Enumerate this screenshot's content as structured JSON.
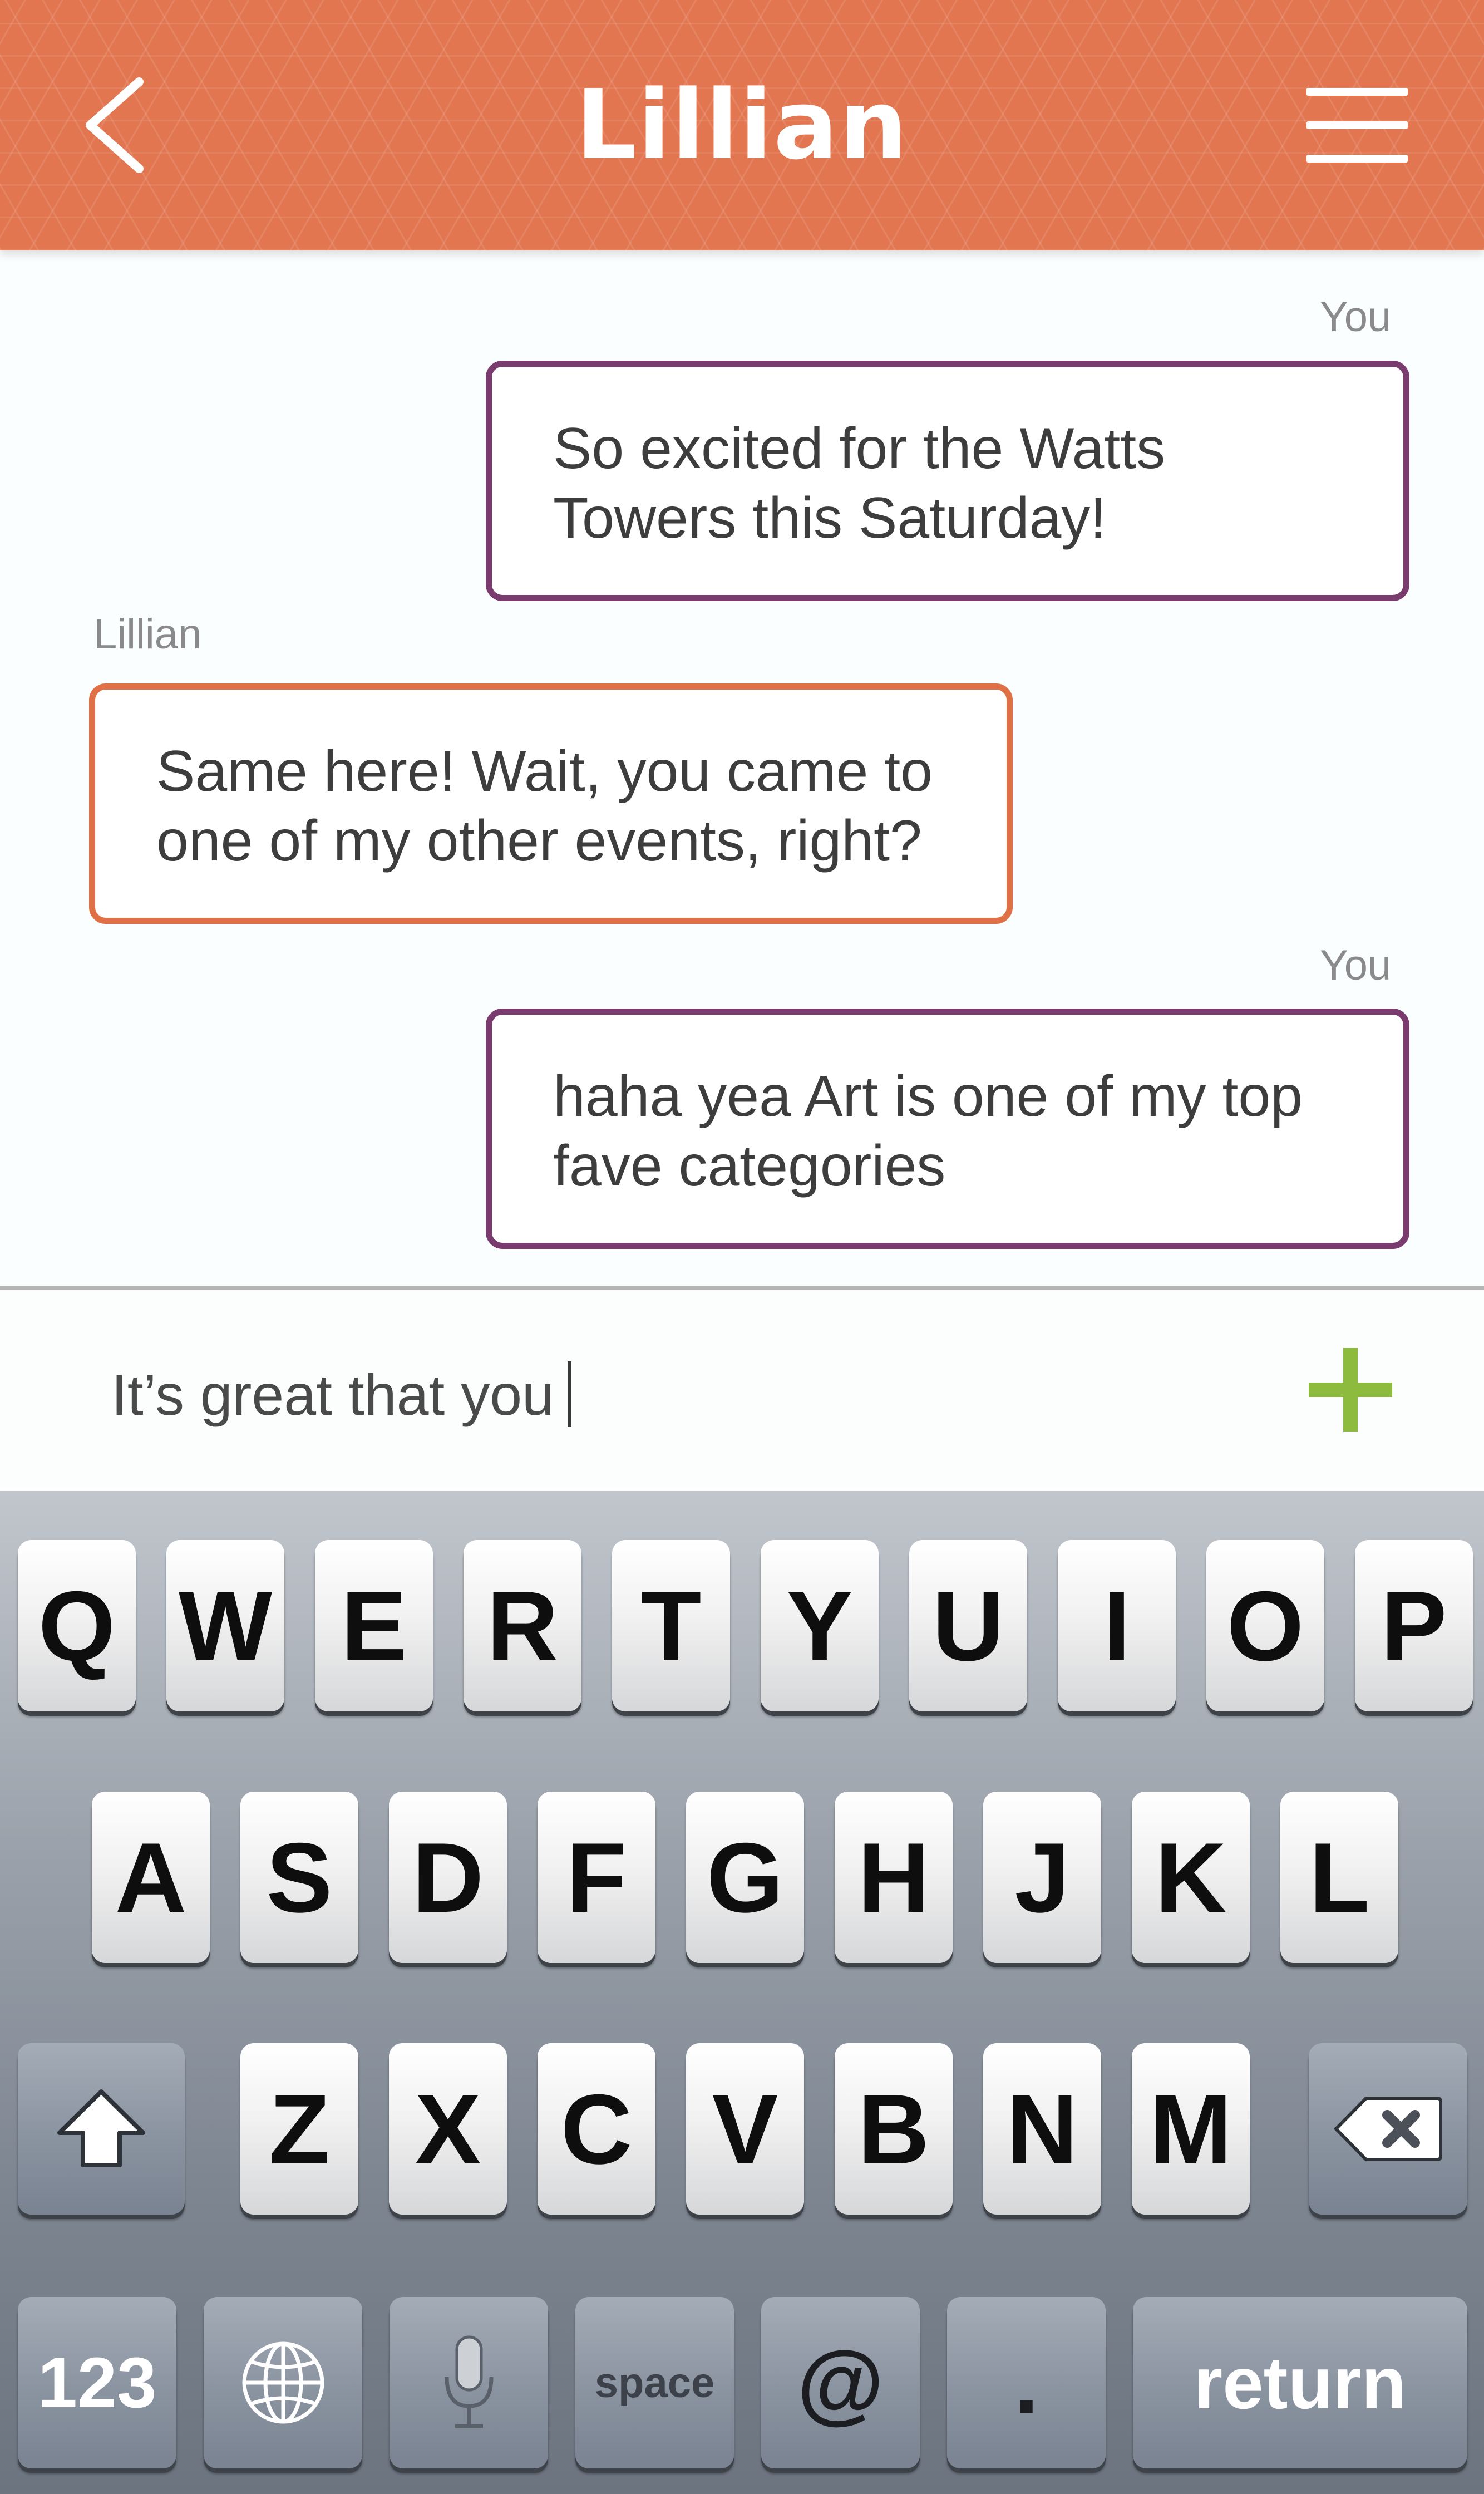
{
  "header": {
    "title": "Lillian",
    "back_icon": "chevron-left-icon",
    "menu_icon": "hamburger-menu-icon",
    "color": "#e27650"
  },
  "messages": [
    {
      "sender": "You",
      "lines": [
        "So excited for the Watts",
        "Towers this Saturday!"
      ],
      "border_color": "#7a3b6e"
    },
    {
      "sender": "Lillian",
      "lines": [
        "Same here! Wait, you came to",
        "one of my other events, right?"
      ],
      "border_color": "#e07146"
    },
    {
      "sender": "You",
      "lines": [
        "haha yea Art is one of my top",
        "fave categories"
      ],
      "border_color": "#7a3b6e"
    }
  ],
  "composer": {
    "value": "It’s great that you",
    "add_icon": "plus-icon",
    "add_color": "#8dbb3d"
  },
  "keyboard": {
    "row1": [
      "Q",
      "W",
      "E",
      "R",
      "T",
      "Y",
      "U",
      "I",
      "O",
      "P"
    ],
    "row2": [
      "A",
      "S",
      "D",
      "F",
      "G",
      "H",
      "J",
      "K",
      "L"
    ],
    "row3": [
      "Z",
      "X",
      "C",
      "V",
      "B",
      "N",
      "M"
    ],
    "shift_icon": "shift-arrow-icon",
    "backspace_icon": "backspace-icon",
    "numbers_label": "123",
    "globe_icon": "globe-icon",
    "mic_icon": "microphone-icon",
    "space_label": "space",
    "at_label": "@",
    "period_label": ".",
    "return_label": "return"
  }
}
